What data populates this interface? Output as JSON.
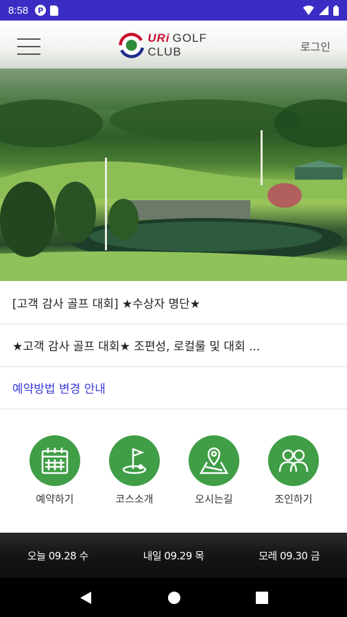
{
  "status_bar": {
    "time": "8:58"
  },
  "header": {
    "brand_mark": "URi",
    "brand_name": "GOLF CLUB",
    "login_label": "로그인"
  },
  "hero": {
    "slide_count": 2,
    "active_slide": 1
  },
  "notices": [
    {
      "text": "[고객 감사 골프 대회] ★수상자 명단★"
    },
    {
      "text": "★고객 감사 골프 대회★ 조편성, 로컬룰 및 대회 ..."
    },
    {
      "text": "예약방법 변경 안내"
    }
  ],
  "quick_menu": [
    {
      "label": "예약하기",
      "icon": "calendar-icon"
    },
    {
      "label": "코스소개",
      "icon": "flag-icon"
    },
    {
      "label": "오시는길",
      "icon": "map-pin-icon"
    },
    {
      "label": "조인하기",
      "icon": "people-icon"
    }
  ],
  "dates": [
    {
      "label": "오늘 09.28 수"
    },
    {
      "label": "내일 09.29 목"
    },
    {
      "label": "모레 09.30 금"
    }
  ],
  "colors": {
    "status_bar": "#3b2dc4",
    "accent_green": "#3f9e46",
    "link_blue": "#3a3ad8"
  }
}
